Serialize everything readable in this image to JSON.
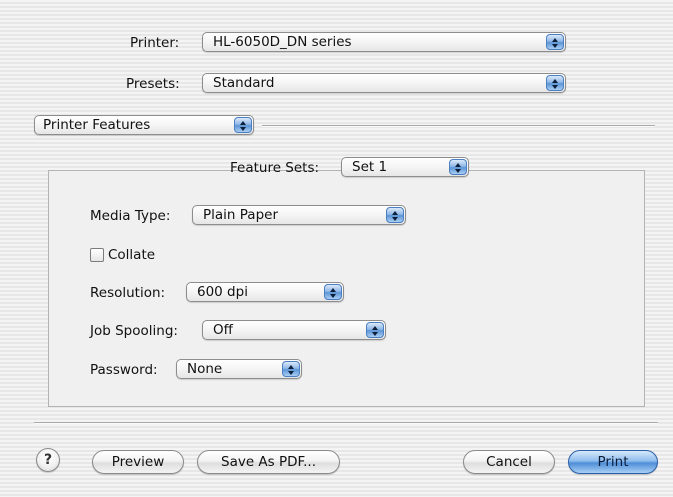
{
  "printer": {
    "label": "Printer:",
    "value": "HL-6050D_DN series"
  },
  "presets": {
    "label": "Presets:",
    "value": "Standard"
  },
  "section": {
    "value": "Printer Features"
  },
  "feature_sets": {
    "label": "Feature Sets:",
    "value": "Set 1"
  },
  "fields": {
    "media_type": {
      "label": "Media Type:",
      "value": "Plain Paper"
    },
    "collate": {
      "label": "Collate",
      "checked": false
    },
    "resolution": {
      "label": "Resolution:",
      "value": "600 dpi"
    },
    "job_spooling": {
      "label": "Job Spooling:",
      "value": "Off"
    },
    "password": {
      "label": "Password:",
      "value": "None"
    }
  },
  "buttons": {
    "help": "?",
    "preview": "Preview",
    "save_pdf": "Save As PDF...",
    "cancel": "Cancel",
    "print": "Print"
  },
  "icons": {
    "popup_arrows": "updown-arrows-icon",
    "help": "question-icon"
  },
  "colors": {
    "accent": "#5d95d6",
    "default_button": "#4f8ed8",
    "window_bg": "#ececec"
  }
}
